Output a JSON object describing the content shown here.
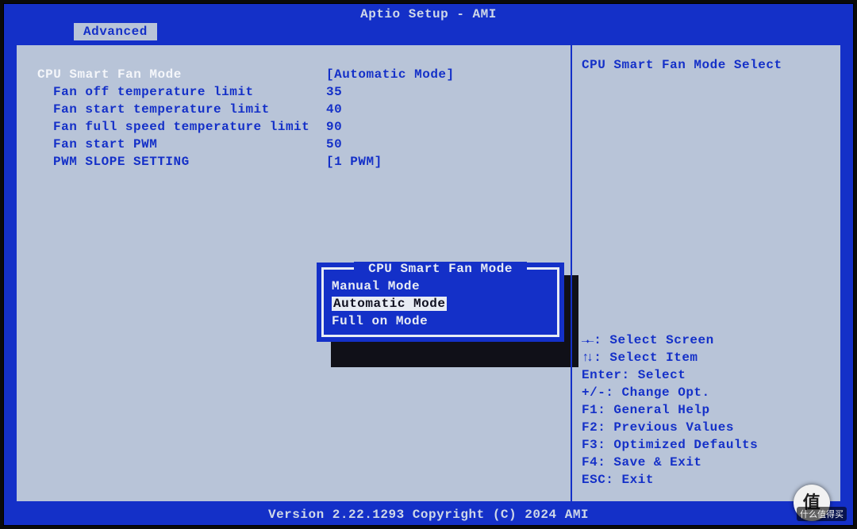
{
  "title": "Aptio Setup - AMI",
  "tab": "Advanced",
  "settings": {
    "main": {
      "label": "CPU Smart Fan Mode",
      "value": "[Automatic Mode]"
    },
    "rows": [
      {
        "label": "Fan off temperature limit",
        "value": "35"
      },
      {
        "label": "Fan start temperature limit",
        "value": "40"
      },
      {
        "label": "Fan full speed temperature limit",
        "value": "90"
      },
      {
        "label": "Fan start PWM",
        "value": "50"
      },
      {
        "label": "PWM SLOPE SETTING",
        "value": "[1 PWM]"
      }
    ]
  },
  "help_title": "CPU Smart Fan Mode Select",
  "keys": {
    "lr": ": Select Screen",
    "ud": ": Select Item",
    "enter": "Enter: Select",
    "pm": "+/-: Change Opt.",
    "f1": "F1: General Help",
    "f2": "F2: Previous Values",
    "f3": "F3: Optimized Defaults",
    "f4": "F4: Save & Exit",
    "esc": "ESC: Exit"
  },
  "popup": {
    "title": " CPU Smart Fan Mode ",
    "options": [
      "Manual Mode",
      "Automatic Mode",
      "Full on Mode"
    ],
    "selected_index": 1
  },
  "footer": "Version 2.22.1293 Copyright (C) 2024 AMI",
  "watermark": {
    "symbol": "值",
    "text": "什么值得买"
  }
}
